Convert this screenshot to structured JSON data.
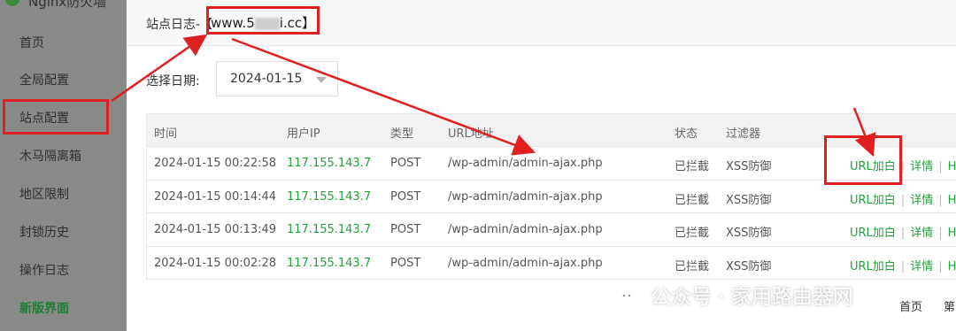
{
  "sidebar": {
    "title": "Nginx防火墙",
    "items": [
      {
        "label": "首页"
      },
      {
        "label": "全局配置"
      },
      {
        "label": "站点配置"
      },
      {
        "label": "木马隔离箱"
      },
      {
        "label": "地区限制"
      },
      {
        "label": "封锁历史"
      },
      {
        "label": "操作日志"
      },
      {
        "label": "新版界面"
      }
    ]
  },
  "modal": {
    "title_prefix": "站点日志-【",
    "site_left": "www.5",
    "site_right": "i.cc】",
    "date_label": "选择日期:",
    "date_value": "2024-01-15"
  },
  "table": {
    "headers": [
      "时间",
      "用户IP",
      "类型",
      "URL地址",
      "状态",
      "过滤器"
    ],
    "rows": [
      {
        "time": "2024-01-15 00:22:58",
        "ip": "117.155.143.7",
        "type": "POST",
        "url": "/wp-admin/admin-ajax.php",
        "status": "已拦截",
        "filter": "XSS防御"
      },
      {
        "time": "2024-01-15 00:14:44",
        "ip": "117.155.143.7",
        "type": "POST",
        "url": "/wp-admin/admin-ajax.php",
        "status": "已拦截",
        "filter": "XSS防御"
      },
      {
        "time": "2024-01-15 00:13:49",
        "ip": "117.155.143.7",
        "type": "POST",
        "url": "/wp-admin/admin-ajax.php",
        "status": "已拦截",
        "filter": "XSS防御"
      },
      {
        "time": "2024-01-15 00:02:28",
        "ip": "117.155.143.7",
        "type": "POST",
        "url": "/wp-admin/admin-ajax.php",
        "status": "已拦截",
        "filter": "XSS防御"
      }
    ],
    "ops": {
      "whitelist": "URL加白",
      "sep": "|",
      "detail": "详情",
      "more": "H"
    }
  },
  "pager": {
    "first": "首页",
    "next": "第"
  },
  "watermark": {
    "text": "公众号 · 家用路由器网"
  },
  "colors": {
    "accent_green": "#20a53a",
    "annotation_red": "#e02020"
  }
}
